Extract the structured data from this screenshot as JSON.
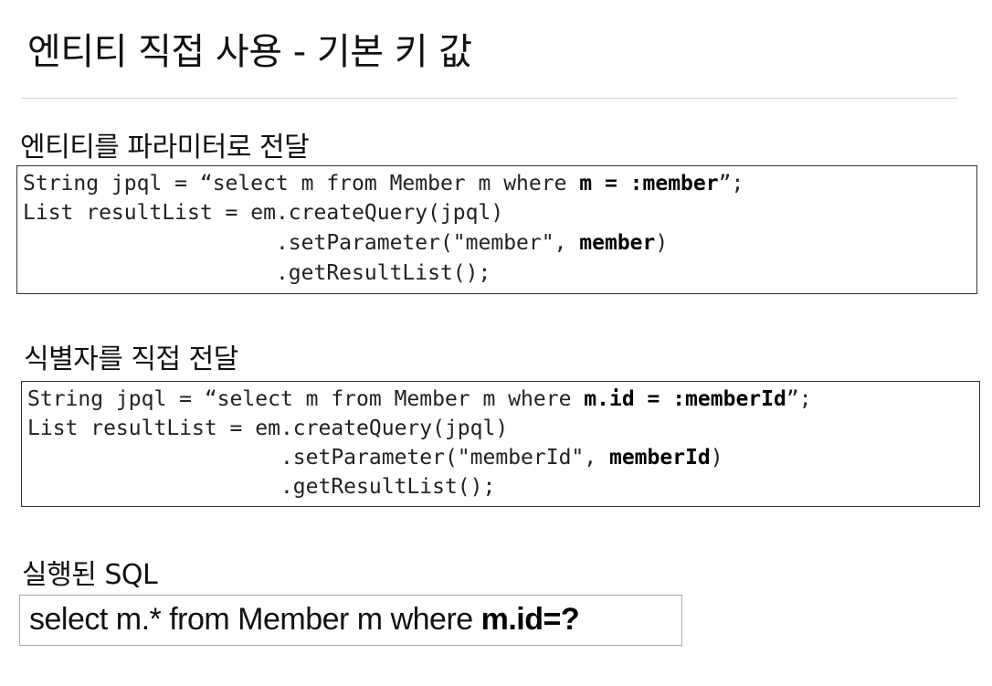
{
  "title": "엔티티 직접 사용 - 기본 키 값",
  "sections": [
    {
      "heading": "엔티티를 파라미터로 전달",
      "code": [
        {
          "plain": "String jpql = “select m from Member m where ",
          "bold": "m = :member",
          "tail": "”;"
        },
        {
          "plain": "List resultList = em.createQuery(jpql)",
          "bold": "",
          "tail": ""
        },
        {
          "plain": "                    .setParameter(\"member\", ",
          "bold": "member",
          "tail": ")"
        },
        {
          "plain": "                    .getResultList();",
          "bold": "",
          "tail": ""
        }
      ]
    },
    {
      "heading": "식별자를 직접 전달",
      "code": [
        {
          "plain": "String jpql = “select m from Member m where ",
          "bold": "m.id = :memberId",
          "tail": "”;"
        },
        {
          "plain": "List resultList = em.createQuery(jpql)",
          "bold": "",
          "tail": ""
        },
        {
          "plain": "                    .setParameter(\"memberId\", ",
          "bold": "memberId",
          "tail": ")"
        },
        {
          "plain": "                    .getResultList();",
          "bold": "",
          "tail": ""
        }
      ]
    },
    {
      "heading": "실행된 SQL",
      "sql": {
        "plain": "select m.* from Member m where ",
        "bold": "m.id=?"
      }
    }
  ]
}
